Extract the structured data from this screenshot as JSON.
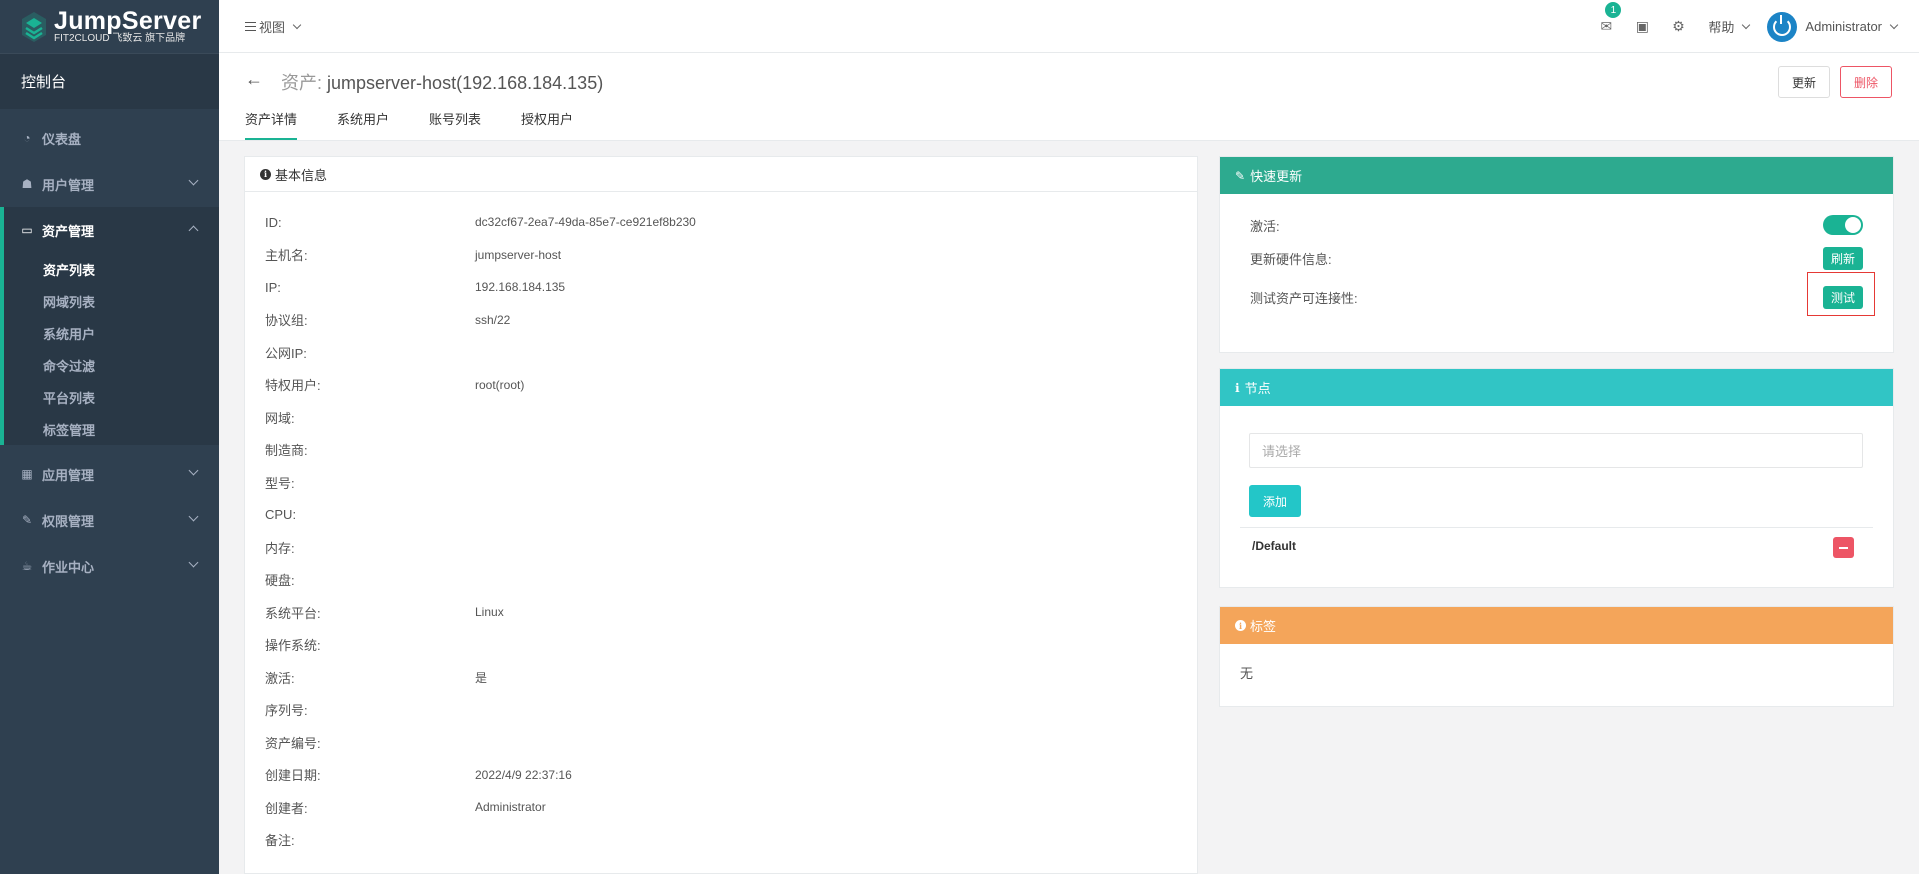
{
  "brand": {
    "title": "JumpServer",
    "subtitle": "FIT2CLOUD 飞致云 旗下品牌"
  },
  "sidebar": {
    "console": "控制台",
    "items": [
      {
        "label": "仪表盘",
        "icon": "dashboard-icon"
      },
      {
        "label": "用户管理",
        "icon": "users-icon"
      },
      {
        "label": "资产管理",
        "icon": "inbox-icon"
      },
      {
        "label": "应用管理",
        "icon": "grid-icon"
      },
      {
        "label": "权限管理",
        "icon": "edit-icon"
      },
      {
        "label": "作业中心",
        "icon": "coffee-icon"
      }
    ],
    "submenu": [
      "资产列表",
      "网域列表",
      "系统用户",
      "命令过滤",
      "平台列表",
      "标签管理"
    ]
  },
  "topbar": {
    "view": "视图",
    "badge": "1",
    "help": "帮助",
    "user": "Administrator"
  },
  "header": {
    "title_prefix": "资产:",
    "title": "jumpserver-host(192.168.184.135)",
    "update": "更新",
    "delete": "删除",
    "tabs": [
      "资产详情",
      "系统用户",
      "账号列表",
      "授权用户"
    ]
  },
  "basic": {
    "title": "基本信息",
    "rows": [
      {
        "k": "ID:",
        "v": "dc32cf67-2ea7-49da-85e7-ce921ef8b230"
      },
      {
        "k": "主机名:",
        "v": "jumpserver-host"
      },
      {
        "k": "IP:",
        "v": "192.168.184.135"
      },
      {
        "k": "协议组:",
        "v": "ssh/22"
      },
      {
        "k": "公网IP:",
        "v": ""
      },
      {
        "k": "特权用户:",
        "v": "root(root)"
      },
      {
        "k": "网域:",
        "v": ""
      },
      {
        "k": "制造商:",
        "v": ""
      },
      {
        "k": "型号:",
        "v": ""
      },
      {
        "k": "CPU:",
        "v": ""
      },
      {
        "k": "内存:",
        "v": ""
      },
      {
        "k": "硬盘:",
        "v": ""
      },
      {
        "k": "系统平台:",
        "v": "Linux"
      },
      {
        "k": "操作系统:",
        "v": ""
      },
      {
        "k": "激活:",
        "v": "是"
      },
      {
        "k": "序列号:",
        "v": ""
      },
      {
        "k": "资产编号:",
        "v": ""
      },
      {
        "k": "创建日期:",
        "v": "2022/4/9 22:37:16"
      },
      {
        "k": "创建者:",
        "v": "Administrator"
      },
      {
        "k": "备注:",
        "v": ""
      }
    ]
  },
  "quick_update": {
    "title": "快速更新",
    "active_label": "激活:",
    "active": true,
    "hardware_label": "更新硬件信息:",
    "refresh": "刷新",
    "test_label": "测试资产可连接性:",
    "test": "测试"
  },
  "nodes": {
    "title": "节点",
    "placeholder": "请选择",
    "add": "添加",
    "items": [
      "/Default"
    ]
  },
  "tags": {
    "title": "标签",
    "empty": "无"
  },
  "colors": {
    "sidebar": "#2f4050",
    "primary": "#1ab394",
    "info": "#23c6c8",
    "warning": "#f4a55a",
    "danger": "#ed5565"
  }
}
